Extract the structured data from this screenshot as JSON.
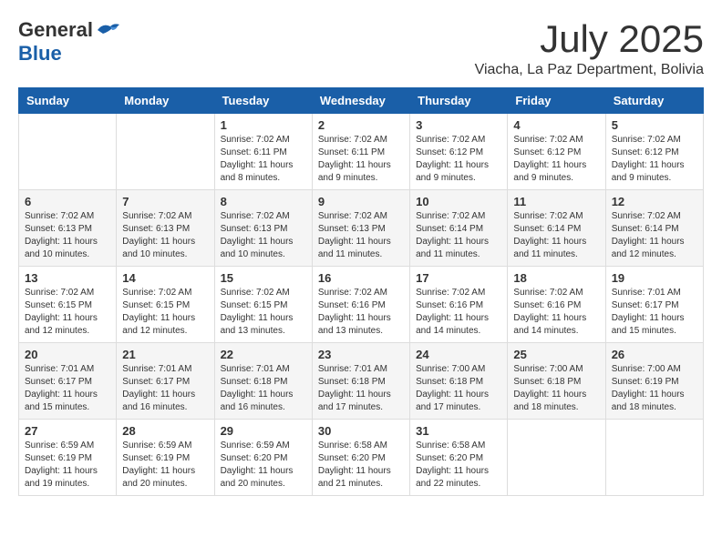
{
  "logo": {
    "general": "General",
    "blue": "Blue"
  },
  "title": {
    "month": "July 2025",
    "location": "Viacha, La Paz Department, Bolivia"
  },
  "weekdays": [
    "Sunday",
    "Monday",
    "Tuesday",
    "Wednesday",
    "Thursday",
    "Friday",
    "Saturday"
  ],
  "weeks": [
    [
      null,
      null,
      {
        "day": "1",
        "sunrise": "Sunrise: 7:02 AM",
        "sunset": "Sunset: 6:11 PM",
        "daylight": "Daylight: 11 hours and 8 minutes."
      },
      {
        "day": "2",
        "sunrise": "Sunrise: 7:02 AM",
        "sunset": "Sunset: 6:11 PM",
        "daylight": "Daylight: 11 hours and 9 minutes."
      },
      {
        "day": "3",
        "sunrise": "Sunrise: 7:02 AM",
        "sunset": "Sunset: 6:12 PM",
        "daylight": "Daylight: 11 hours and 9 minutes."
      },
      {
        "day": "4",
        "sunrise": "Sunrise: 7:02 AM",
        "sunset": "Sunset: 6:12 PM",
        "daylight": "Daylight: 11 hours and 9 minutes."
      },
      {
        "day": "5",
        "sunrise": "Sunrise: 7:02 AM",
        "sunset": "Sunset: 6:12 PM",
        "daylight": "Daylight: 11 hours and 9 minutes."
      }
    ],
    [
      {
        "day": "6",
        "sunrise": "Sunrise: 7:02 AM",
        "sunset": "Sunset: 6:13 PM",
        "daylight": "Daylight: 11 hours and 10 minutes."
      },
      {
        "day": "7",
        "sunrise": "Sunrise: 7:02 AM",
        "sunset": "Sunset: 6:13 PM",
        "daylight": "Daylight: 11 hours and 10 minutes."
      },
      {
        "day": "8",
        "sunrise": "Sunrise: 7:02 AM",
        "sunset": "Sunset: 6:13 PM",
        "daylight": "Daylight: 11 hours and 10 minutes."
      },
      {
        "day": "9",
        "sunrise": "Sunrise: 7:02 AM",
        "sunset": "Sunset: 6:13 PM",
        "daylight": "Daylight: 11 hours and 11 minutes."
      },
      {
        "day": "10",
        "sunrise": "Sunrise: 7:02 AM",
        "sunset": "Sunset: 6:14 PM",
        "daylight": "Daylight: 11 hours and 11 minutes."
      },
      {
        "day": "11",
        "sunrise": "Sunrise: 7:02 AM",
        "sunset": "Sunset: 6:14 PM",
        "daylight": "Daylight: 11 hours and 11 minutes."
      },
      {
        "day": "12",
        "sunrise": "Sunrise: 7:02 AM",
        "sunset": "Sunset: 6:14 PM",
        "daylight": "Daylight: 11 hours and 12 minutes."
      }
    ],
    [
      {
        "day": "13",
        "sunrise": "Sunrise: 7:02 AM",
        "sunset": "Sunset: 6:15 PM",
        "daylight": "Daylight: 11 hours and 12 minutes."
      },
      {
        "day": "14",
        "sunrise": "Sunrise: 7:02 AM",
        "sunset": "Sunset: 6:15 PM",
        "daylight": "Daylight: 11 hours and 12 minutes."
      },
      {
        "day": "15",
        "sunrise": "Sunrise: 7:02 AM",
        "sunset": "Sunset: 6:15 PM",
        "daylight": "Daylight: 11 hours and 13 minutes."
      },
      {
        "day": "16",
        "sunrise": "Sunrise: 7:02 AM",
        "sunset": "Sunset: 6:16 PM",
        "daylight": "Daylight: 11 hours and 13 minutes."
      },
      {
        "day": "17",
        "sunrise": "Sunrise: 7:02 AM",
        "sunset": "Sunset: 6:16 PM",
        "daylight": "Daylight: 11 hours and 14 minutes."
      },
      {
        "day": "18",
        "sunrise": "Sunrise: 7:02 AM",
        "sunset": "Sunset: 6:16 PM",
        "daylight": "Daylight: 11 hours and 14 minutes."
      },
      {
        "day": "19",
        "sunrise": "Sunrise: 7:01 AM",
        "sunset": "Sunset: 6:17 PM",
        "daylight": "Daylight: 11 hours and 15 minutes."
      }
    ],
    [
      {
        "day": "20",
        "sunrise": "Sunrise: 7:01 AM",
        "sunset": "Sunset: 6:17 PM",
        "daylight": "Daylight: 11 hours and 15 minutes."
      },
      {
        "day": "21",
        "sunrise": "Sunrise: 7:01 AM",
        "sunset": "Sunset: 6:17 PM",
        "daylight": "Daylight: 11 hours and 16 minutes."
      },
      {
        "day": "22",
        "sunrise": "Sunrise: 7:01 AM",
        "sunset": "Sunset: 6:18 PM",
        "daylight": "Daylight: 11 hours and 16 minutes."
      },
      {
        "day": "23",
        "sunrise": "Sunrise: 7:01 AM",
        "sunset": "Sunset: 6:18 PM",
        "daylight": "Daylight: 11 hours and 17 minutes."
      },
      {
        "day": "24",
        "sunrise": "Sunrise: 7:00 AM",
        "sunset": "Sunset: 6:18 PM",
        "daylight": "Daylight: 11 hours and 17 minutes."
      },
      {
        "day": "25",
        "sunrise": "Sunrise: 7:00 AM",
        "sunset": "Sunset: 6:18 PM",
        "daylight": "Daylight: 11 hours and 18 minutes."
      },
      {
        "day": "26",
        "sunrise": "Sunrise: 7:00 AM",
        "sunset": "Sunset: 6:19 PM",
        "daylight": "Daylight: 11 hours and 18 minutes."
      }
    ],
    [
      {
        "day": "27",
        "sunrise": "Sunrise: 6:59 AM",
        "sunset": "Sunset: 6:19 PM",
        "daylight": "Daylight: 11 hours and 19 minutes."
      },
      {
        "day": "28",
        "sunrise": "Sunrise: 6:59 AM",
        "sunset": "Sunset: 6:19 PM",
        "daylight": "Daylight: 11 hours and 20 minutes."
      },
      {
        "day": "29",
        "sunrise": "Sunrise: 6:59 AM",
        "sunset": "Sunset: 6:20 PM",
        "daylight": "Daylight: 11 hours and 20 minutes."
      },
      {
        "day": "30",
        "sunrise": "Sunrise: 6:58 AM",
        "sunset": "Sunset: 6:20 PM",
        "daylight": "Daylight: 11 hours and 21 minutes."
      },
      {
        "day": "31",
        "sunrise": "Sunrise: 6:58 AM",
        "sunset": "Sunset: 6:20 PM",
        "daylight": "Daylight: 11 hours and 22 minutes."
      },
      null,
      null
    ]
  ]
}
